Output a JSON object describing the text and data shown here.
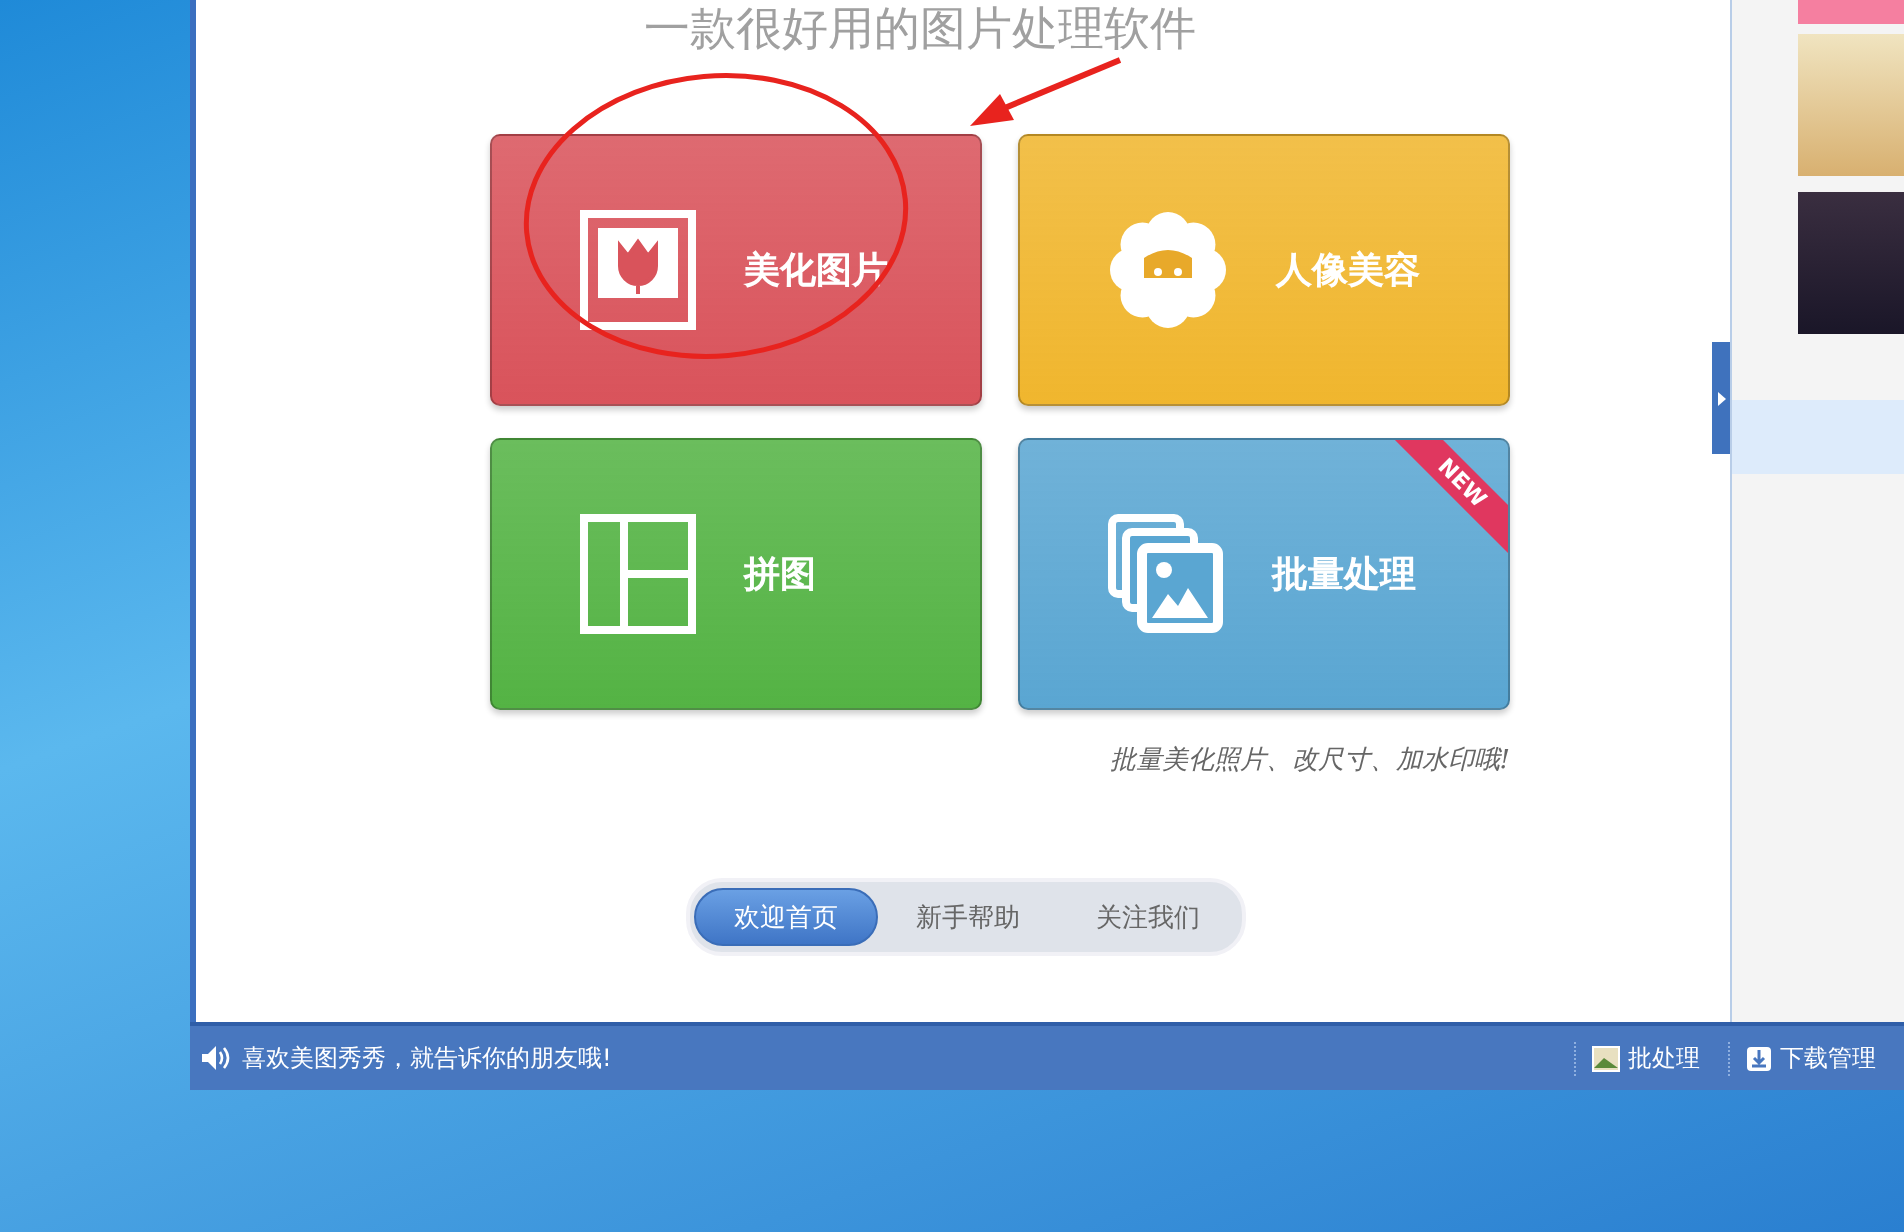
{
  "subtitle": "一款很好用的图片处理软件",
  "tiles": [
    {
      "label": "美化图片",
      "kind": "beautify",
      "color": "#d9535b"
    },
    {
      "label": "人像美容",
      "kind": "portrait",
      "color": "#f0b62e"
    },
    {
      "label": "拼图",
      "kind": "collage",
      "color": "#54b344"
    },
    {
      "label": "批量处理",
      "kind": "batch",
      "color": "#5aa6d2",
      "badge": "NEW"
    }
  ],
  "note": "批量美化照片、改尺寸、加水印哦!",
  "nav": [
    {
      "label": "欢迎首页",
      "selected": true
    },
    {
      "label": "新手帮助",
      "selected": false
    },
    {
      "label": "关注我们",
      "selected": false
    }
  ],
  "status_bar": {
    "message": "喜欢美图秀秀，就告诉你的朋友哦!",
    "actions": [
      {
        "label": "批处理",
        "kind": "batch"
      },
      {
        "label": "下载管理",
        "kind": "download"
      }
    ]
  }
}
